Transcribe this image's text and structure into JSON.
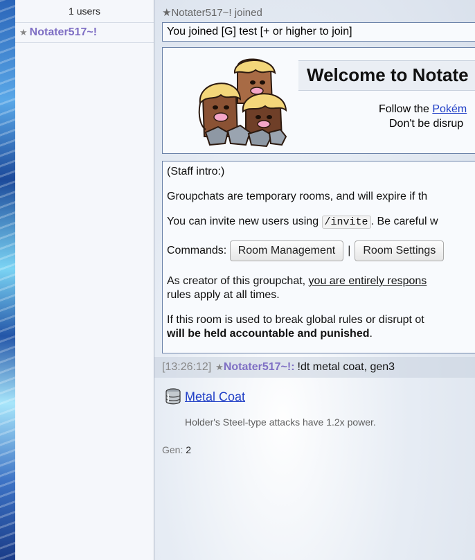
{
  "userlist": {
    "count_label": "1 users",
    "users": [
      {
        "rank_icon": "★",
        "name": "Notater517~!"
      }
    ]
  },
  "chat": {
    "joined": {
      "star": "★",
      "text": "Notater517~! joined"
    },
    "notice": "You joined [G] test [+ or higher to join]",
    "welcome": {
      "title": "Welcome to Notate",
      "follow_prefix": "Follow the ",
      "follow_link": "Pokém",
      "disrupt_text": "Don't be disrup"
    },
    "staff_intro": {
      "intro": "(Staff intro:)",
      "groupchats": "Groupchats are temporary rooms, and will expire if th",
      "invite_prefix": "You can invite new users using ",
      "invite_code": "/invite",
      "invite_suffix": ". Be careful w",
      "commands_label": "Commands:",
      "room_management_button": "Room Management",
      "separator": "|",
      "room_settings_button": "Room Settings",
      "creator_prefix": "As creator of this groupchat, ",
      "creator_underlined": "you are entirely respons",
      "creator_line2": "rules apply at all times.",
      "if_line1": "If this room is used to break global rules or disrupt ot",
      "if_line2": "will be held accountable and punished",
      "if_line2_suffix": "."
    },
    "message": {
      "timestamp": "[13:26:12]",
      "rank": "★",
      "user": "Notater517~!:",
      "text": "!dt metal coat, gen3"
    },
    "item_result": {
      "icon": "metal-coat-icon",
      "name": "Metal Coat",
      "description": "Holder's Steel-type attacks have 1.2x power.",
      "gen_label": "Gen:",
      "gen_value": "2"
    }
  }
}
